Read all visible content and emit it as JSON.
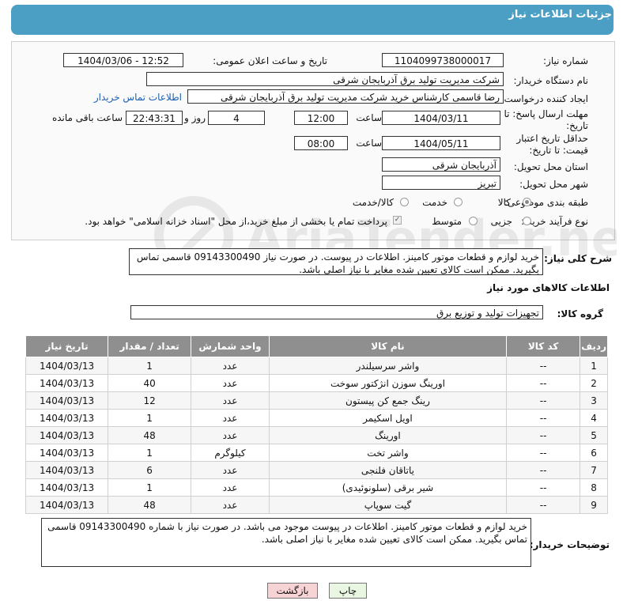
{
  "header": {
    "title": "جزئیات اطلاعات نیاز"
  },
  "form": {
    "need_number_label": "شماره نیاز:",
    "need_number": "1104099738000017",
    "announce_label": "تاریخ و ساعت اعلان عمومی:",
    "announce_value": "1404/03/06 - 12:52",
    "buyer_org_label": "نام دستگاه خریدار:",
    "buyer_org": "شرکت مدیریت تولید برق آذربایجان شرقی",
    "creator_label": "ایجاد کننده درخواست:",
    "creator": "رضا قاسمی کارشناس خرید شرکت مدیریت تولید برق آذربایجان شرقی",
    "buyer_contact_link": "اطلاعات تماس خریدار",
    "reply_deadline_label": "مهلت ارسال پاسخ: تا تاریخ:",
    "reply_date": "1404/03/11",
    "time_label": "ساعت",
    "reply_time": "12:00",
    "days": "4",
    "day_and_label": "روز و",
    "remaining_time": "22:43:31",
    "remaining_label": "ساعت باقی مانده",
    "price_validity_label": "حداقل تاریخ اعتبار قیمت: تا تاریخ:",
    "validity_date": "1404/05/11",
    "validity_time": "08:00",
    "province_label": "استان محل تحویل:",
    "province": "آذربایجان شرقی",
    "city_label": "شهر محل تحویل:",
    "city": "تبریز",
    "category_label": "طبقه بندی موضوعی:",
    "category_options": [
      "کالا",
      "خدمت",
      "کالا/خدمت"
    ],
    "category_selected": "کالا",
    "process_label": "نوع فرآیند خرید :",
    "process_options": [
      "جزیی",
      "متوسط"
    ],
    "payment_note": "پرداخت تمام یا بخشی از مبلغ خرید،از محل \"اسناد خزانه اسلامی\" خواهد بود."
  },
  "description": {
    "label": "شرح کلی نیاز:",
    "text": "خرید لوازم و قطعات موتور کامینز. اطلاعات در پیوست. در صورت نیاز 09143300490 قاسمی تماس بگیرید. ممکن است کالای تعیین شده مغایر با نیاز اصلی باشد."
  },
  "items_section": {
    "title": "اطلاعات کالاهای مورد نیاز",
    "group_label": "گروه کالا:",
    "group_value": "تجهیزات تولید و توزیع برق",
    "columns": [
      "ردیف",
      "کد کالا",
      "نام کالا",
      "واحد شمارش",
      "تعداد / مقدار",
      "تاریخ نیاز"
    ],
    "rows": [
      [
        "1",
        "--",
        "واشر سرسیلندر",
        "عدد",
        "1",
        "1404/03/13"
      ],
      [
        "2",
        "--",
        "اورینگ سوزن انژکتور سوخت",
        "عدد",
        "40",
        "1404/03/13"
      ],
      [
        "3",
        "--",
        "رینگ جمع کن پیستون",
        "عدد",
        "12",
        "1404/03/13"
      ],
      [
        "4",
        "--",
        "اویل اسکیمر",
        "عدد",
        "1",
        "1404/03/13"
      ],
      [
        "5",
        "--",
        "اورینگ",
        "عدد",
        "48",
        "1404/03/13"
      ],
      [
        "6",
        "--",
        "واشر تخت",
        "کیلوگرم",
        "1",
        "1404/03/13"
      ],
      [
        "7",
        "--",
        "یاتاقان فلنجی",
        "عدد",
        "6",
        "1404/03/13"
      ],
      [
        "8",
        "--",
        "شیر برقی (سلونوئیدی)",
        "عدد",
        "1",
        "1404/03/13"
      ],
      [
        "9",
        "--",
        "گیت سوپاپ",
        "عدد",
        "48",
        "1404/03/13"
      ]
    ]
  },
  "buyer_notes": {
    "label": "توضیحات خریدار:",
    "text": "خرید لوازم و قطعات موتور کامینز. اطلاعات در پیوست موجود می باشد. در صورت نیاز با شماره 09143300490 قاسمی تماس بگیرید. ممکن است کالای تعیین شده مغایر با نیاز اصلی باشد."
  },
  "buttons": {
    "print": "چاپ",
    "back": "بازگشت"
  },
  "watermark": {
    "text": "AriaTender.neT"
  },
  "colors": {
    "header": "#4c9fc4",
    "table_header": "#8f8f8f",
    "back_button": "#f7d3d6",
    "print_button": "#e9f7e2"
  }
}
